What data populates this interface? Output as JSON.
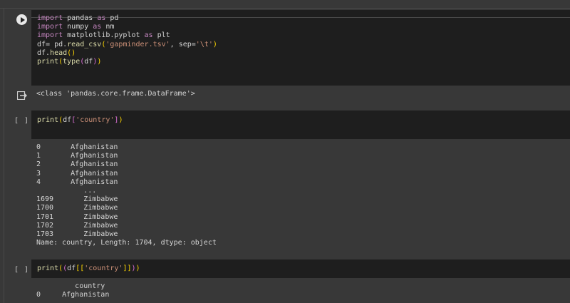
{
  "cells": [
    {
      "type": "code",
      "run_button": true,
      "lines": [
        [
          [
            "import ",
            "kw"
          ],
          [
            "pandas ",
            "txt"
          ],
          [
            "as ",
            "kw"
          ],
          [
            "pd",
            "txt"
          ]
        ],
        [
          [
            "import ",
            "kw"
          ],
          [
            "numpy ",
            "txt"
          ],
          [
            "as ",
            "kw"
          ],
          [
            "nm",
            "txt"
          ]
        ],
        [
          [
            "import ",
            "kw"
          ],
          [
            "matplotlib.pyplot ",
            "txt"
          ],
          [
            "as ",
            "kw"
          ],
          [
            "plt",
            "txt"
          ]
        ],
        [
          [
            "df= pd.",
            "txt"
          ],
          [
            "read_csv",
            "fn"
          ],
          [
            "(",
            "br"
          ],
          [
            "'gapminder.tsv'",
            "str"
          ],
          [
            ", sep=",
            "txt"
          ],
          [
            "'\\t'",
            "str"
          ],
          [
            ")",
            "br"
          ]
        ],
        [
          [
            "df.",
            "txt"
          ],
          [
            "head",
            "fn"
          ],
          [
            "()",
            "br"
          ]
        ],
        [
          [
            "print",
            "fn"
          ],
          [
            "(",
            "br"
          ],
          [
            "type",
            "fn"
          ],
          [
            "(",
            "br2"
          ],
          [
            "df",
            "txt"
          ],
          [
            ")",
            "br2"
          ],
          [
            ")",
            "br"
          ]
        ]
      ],
      "output": [
        "<class 'pandas.core.frame.DataFrame'>"
      ]
    },
    {
      "type": "code",
      "brackets": "[ ]",
      "lines": [
        [
          [
            "print",
            "fn"
          ],
          [
            "(",
            "br"
          ],
          [
            "df",
            "txt"
          ],
          [
            "[",
            "br2"
          ],
          [
            "'country'",
            "str"
          ],
          [
            "]",
            "br2"
          ],
          [
            ")",
            "br"
          ]
        ]
      ],
      "output": [
        "0       Afghanistan",
        "1       Afghanistan",
        "2       Afghanistan",
        "3       Afghanistan",
        "4       Afghanistan",
        "           ...",
        "1699       Zimbabwe",
        "1700       Zimbabwe",
        "1701       Zimbabwe",
        "1702       Zimbabwe",
        "1703       Zimbabwe",
        "Name: country, Length: 1704, dtype: object"
      ]
    },
    {
      "type": "code",
      "brackets": "[ ]",
      "lines": [
        [
          [
            "print",
            "fn"
          ],
          [
            "(",
            "br"
          ],
          [
            "(",
            "br2"
          ],
          [
            "df",
            "txt"
          ],
          [
            "[[",
            "br"
          ],
          [
            "'country'",
            "str"
          ],
          [
            "]]",
            "br"
          ],
          [
            ")",
            "br2"
          ],
          [
            ")",
            "br"
          ]
        ]
      ],
      "output": [
        "         country",
        "0     Afghanistan"
      ]
    }
  ]
}
